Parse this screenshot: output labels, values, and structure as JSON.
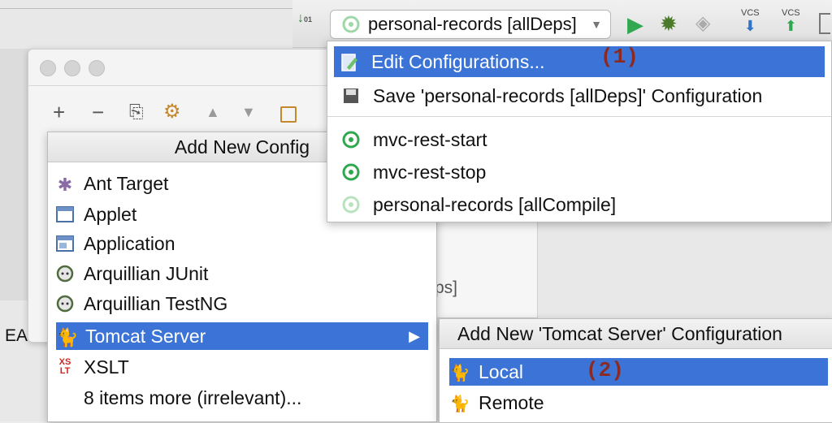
{
  "toolbar": {
    "run_config": "personal-records [allDeps]",
    "vcs1": "VCS",
    "vcs2": "VCS"
  },
  "run_dropdown": {
    "items": [
      {
        "label": "Edit Configurations...",
        "icon": "edit-config-icon",
        "selected": true
      },
      {
        "label": "Save 'personal-records [allDeps]' Configuration",
        "icon": "save-icon"
      },
      {
        "label": "mvc-rest-start",
        "icon": "gradle-icon"
      },
      {
        "label": "mvc-rest-stop",
        "icon": "gradle-icon"
      },
      {
        "label": "personal-records [allCompile]",
        "icon": "gradle-icon-faded"
      }
    ],
    "annotation": "(1)"
  },
  "dialog": {
    "toolbar_buttons": [
      "+",
      "−",
      "⎘",
      "⚙",
      "▲",
      "▼"
    ]
  },
  "add_menu": {
    "header": "Add New Config",
    "items": [
      {
        "label": "Ant Target",
        "icon": "ant-icon"
      },
      {
        "label": "Applet",
        "icon": "applet-icon"
      },
      {
        "label": "Application",
        "icon": "application-icon"
      },
      {
        "label": "Arquillian JUnit",
        "icon": "arquillian-icon"
      },
      {
        "label": "Arquillian TestNG",
        "icon": "arquillian-icon"
      },
      {
        "label": "Tomcat Server",
        "icon": "tomcat-icon",
        "selected": true,
        "submenu": true
      },
      {
        "label": "XSLT",
        "icon": "xslt-icon"
      },
      {
        "label": "8 items more (irrelevant)...",
        "icon": ""
      }
    ]
  },
  "tomcat_submenu": {
    "header": "Add New 'Tomcat Server' Configuration",
    "items": [
      {
        "label": "Local",
        "icon": "tomcat-icon",
        "selected": true
      },
      {
        "label": "Remote",
        "icon": "tomcat-icon"
      }
    ],
    "annotation": "(2)"
  },
  "background": {
    "left_fragment": "EASE",
    "mid_fragment": "ps]"
  },
  "colors": {
    "selection": "#3b74d6",
    "annotation": "#8b2a22",
    "run_green": "#2fa84f"
  }
}
